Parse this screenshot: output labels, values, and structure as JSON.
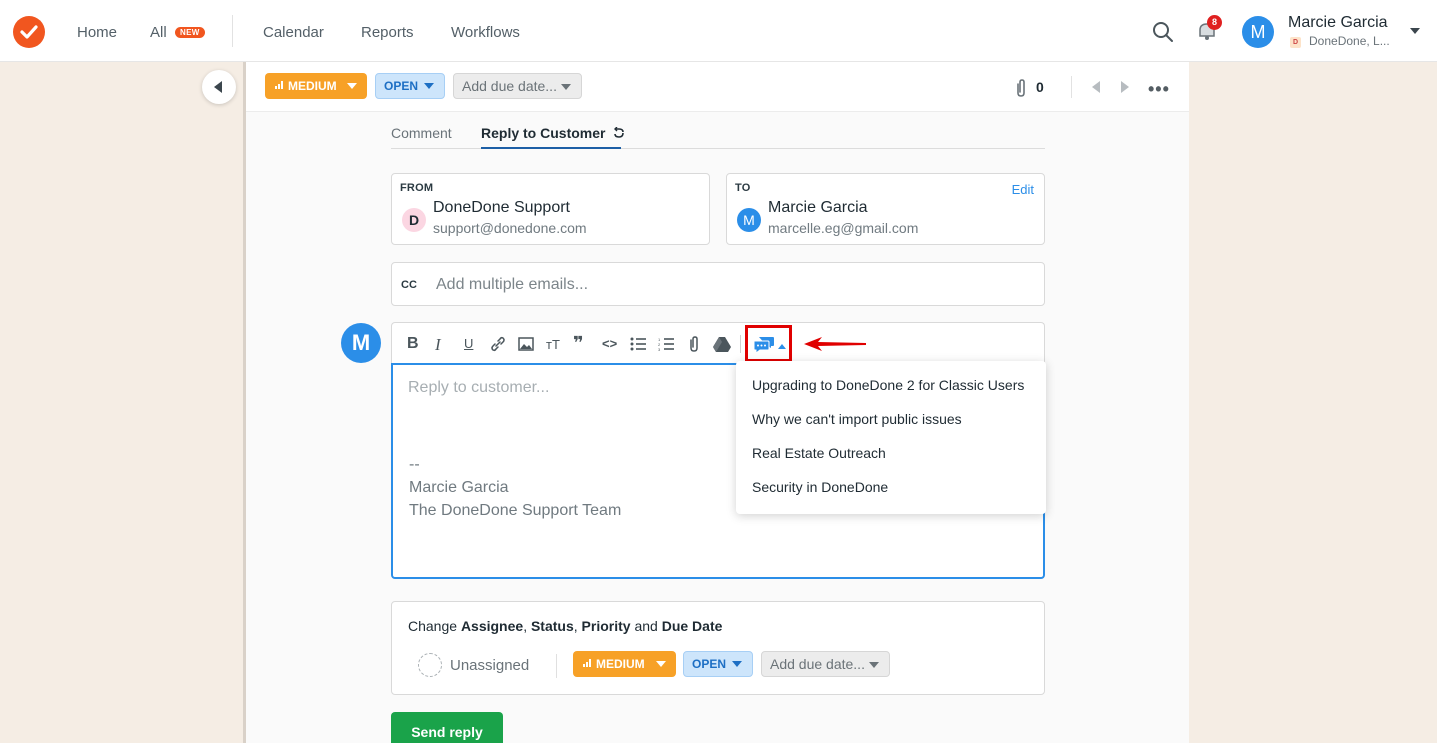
{
  "nav": {
    "home": "Home",
    "all": "All",
    "new_badge": "NEW",
    "calendar": "Calendar",
    "reports": "Reports",
    "workflows": "Workflows",
    "notification_count": "8",
    "user_initial": "M",
    "user_name": "Marcie Garcia",
    "org_initial": "D",
    "org_name": "DoneDone, L..."
  },
  "toolbar": {
    "priority": "MEDIUM",
    "status": "OPEN",
    "due_placeholder": "Add due date...",
    "attachment_count": "0",
    "more": "•••"
  },
  "tabs": {
    "comment": "Comment",
    "reply": "Reply to Customer"
  },
  "from": {
    "label": "FROM",
    "initial": "D",
    "name": "DoneDone Support",
    "email": "support@donedone.com"
  },
  "to": {
    "label": "TO",
    "edit": "Edit",
    "initial": "M",
    "name": "Marcie Garcia",
    "email": "marcelle.eg@gmail.com"
  },
  "cc": {
    "label": "CC",
    "placeholder": "Add multiple emails..."
  },
  "editor": {
    "avatar_initial": "M",
    "placeholder": "Reply to customer...",
    "signature_sep": "--",
    "signature_name": "Marcie Garcia",
    "signature_team": "The DoneDone Support Team"
  },
  "canned_responses": [
    "Upgrading to DoneDone 2 for Classic Users",
    "Why we can't import public issues",
    "Real Estate Outreach",
    "Security in DoneDone"
  ],
  "change": {
    "prefix": "Change ",
    "assignee": "Assignee",
    "sep1": ", ",
    "status": "Status",
    "sep2": ", ",
    "priority": "Priority",
    "and": " and ",
    "due": "Due Date",
    "unassigned": "Unassigned",
    "priority_value": "MEDIUM",
    "status_value": "OPEN",
    "due_placeholder": "Add due date..."
  },
  "send_button": "Send reply",
  "colors": {
    "accent": "#2b8ee8",
    "brand": "#f1561f",
    "priority": "#f7a127",
    "send": "#1aa34a",
    "highlight": "#e00000"
  }
}
